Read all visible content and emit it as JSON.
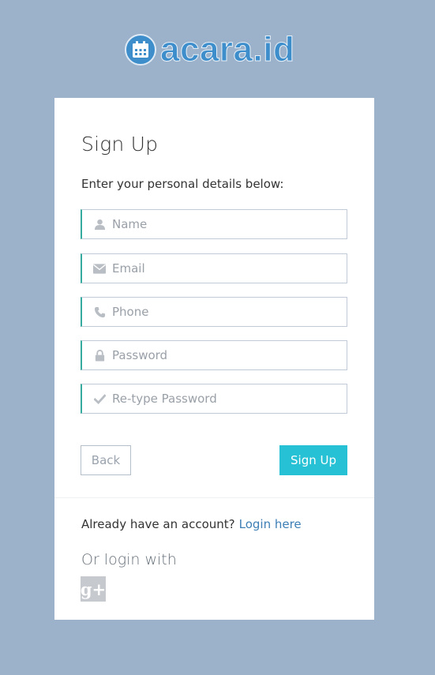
{
  "brand": {
    "name": "acara.id",
    "color": "#3d8ecb",
    "logo_icon": "calendar-icon"
  },
  "page": {
    "background": "#9bb2ca"
  },
  "form": {
    "title": "Sign Up",
    "subtitle": "Enter your personal details below:",
    "fields": [
      {
        "icon": "user-icon",
        "placeholder": "Name",
        "value": ""
      },
      {
        "icon": "envelope-icon",
        "placeholder": "Email",
        "value": ""
      },
      {
        "icon": "phone-icon",
        "placeholder": "Phone",
        "value": ""
      },
      {
        "icon": "lock-icon",
        "placeholder": "Password",
        "value": ""
      },
      {
        "icon": "check-icon",
        "placeholder": "Re-type Password",
        "value": ""
      }
    ],
    "back_label": "Back",
    "submit_label": "Sign Up",
    "accent_color": "#26c1d4",
    "field_border_accent": "#35aa9e"
  },
  "footer": {
    "account_prompt": "Already have an account?",
    "login_link": "Login here",
    "or_login_with": "Or login with",
    "social": [
      {
        "icon": "google-plus-icon",
        "label": "g+"
      }
    ]
  }
}
